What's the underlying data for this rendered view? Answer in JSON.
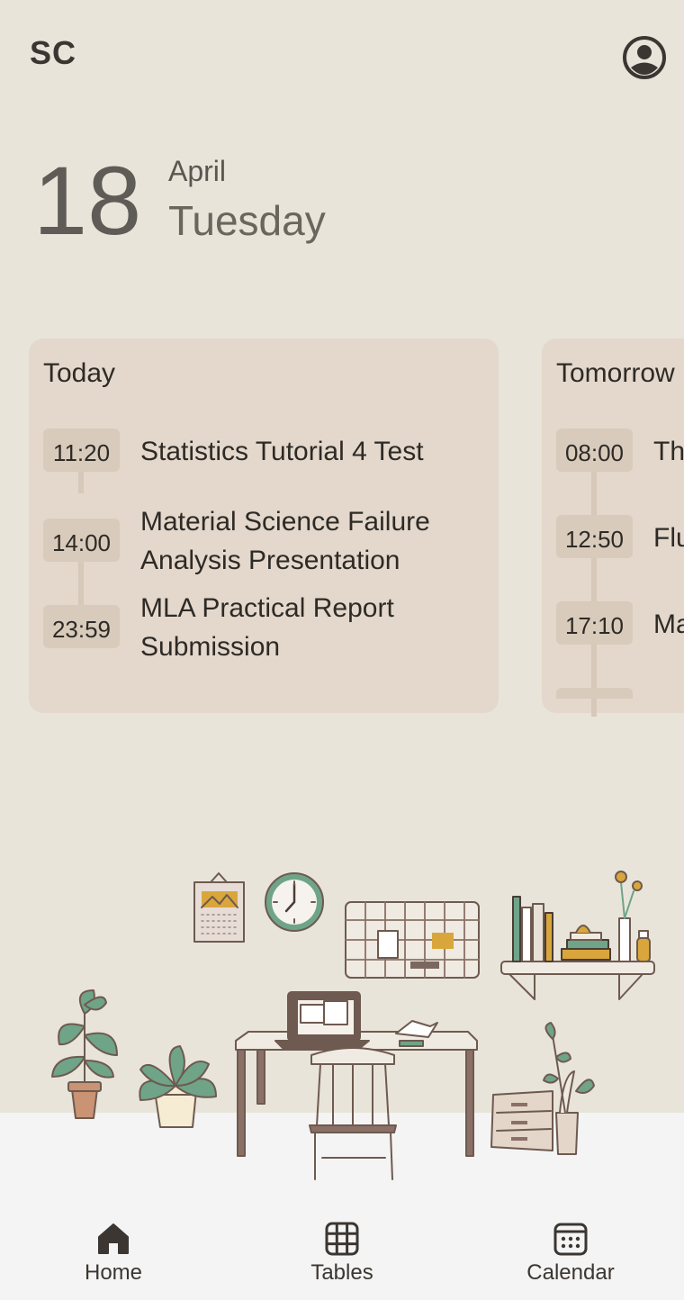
{
  "header": {
    "logo_text": "SC",
    "profile_icon": "account-circle-icon"
  },
  "date": {
    "day": "18",
    "month": "April",
    "weekday": "Tuesday"
  },
  "cards": [
    {
      "title": "Today",
      "events": [
        {
          "time": "11:20",
          "title": "Statistics Tutorial 4 Test"
        },
        {
          "time": "14:00",
          "title_line1": "Material Science Failure",
          "title_line2": "Analysis Presentation"
        },
        {
          "time": "23:59",
          "title_line1": "MLA Practical Report",
          "title_line2": "Submission"
        }
      ]
    },
    {
      "title": "Tomorrow",
      "events": [
        {
          "time": "08:00",
          "title": "Th"
        },
        {
          "time": "12:50",
          "title": "Flu"
        },
        {
          "time": "17:10",
          "title": "Ma"
        }
      ]
    }
  ],
  "nav": [
    {
      "label": "Home",
      "icon": "home-icon",
      "active": true
    },
    {
      "label": "Tables",
      "icon": "grid-icon",
      "active": false
    },
    {
      "label": "Calendar",
      "icon": "calendar-icon",
      "active": false
    }
  ],
  "colors": {
    "background": "#e9e4d9",
    "card": "#e3d8cb",
    "chip": "#d8cbbb",
    "nav": "#f4f4f4"
  }
}
